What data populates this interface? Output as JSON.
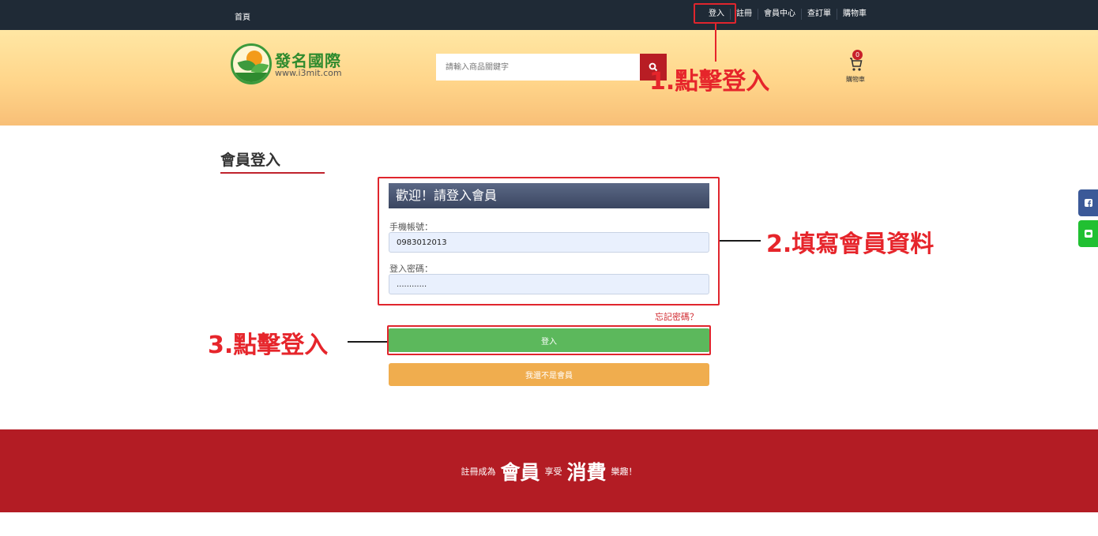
{
  "topbar": {
    "home_label": "首頁",
    "nav": [
      "登入",
      "註冊",
      "會員中心",
      "查訂單",
      "購物車"
    ]
  },
  "header": {
    "logo_name": "發名國際",
    "logo_url": "www.i3mit.com",
    "search_placeholder": "請輸入商品關鍵字",
    "cart_count": "0",
    "cart_label": "購物車"
  },
  "main": {
    "page_title": "會員登入",
    "form_title": "歡迎！請登入會員",
    "phone_label": "手機帳號：",
    "phone_value": "0983012013",
    "password_label": "登入密碼：",
    "password_value": "............",
    "forgot_label": "忘記密碼？",
    "login_button": "登入",
    "join_button": "我還不是會員"
  },
  "annotations": {
    "step1": "1.點擊登入",
    "step2": "2.填寫會員資料",
    "step3": "3.點擊登入"
  },
  "footer": {
    "part1": "註冊成為",
    "part2": "會員",
    "part3": "享受",
    "part4": "消費",
    "part5": "樂趣！"
  },
  "colors": {
    "topbar": "#1f2a36",
    "accent_red": "#b81d24",
    "login_green": "#5cb85c",
    "join_orange": "#f0ad4e",
    "annotation_red": "#e6252b"
  }
}
